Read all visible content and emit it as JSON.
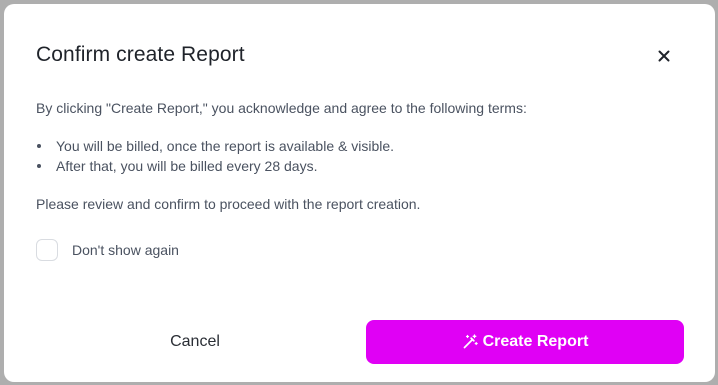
{
  "dialog": {
    "title": "Confirm create Report",
    "intro": "By clicking \"Create Report,\" you acknowledge and agree to the following terms:",
    "terms": [
      "You will be billed, once the report is available & visible.",
      "After that, you will be billed every 28 days."
    ],
    "review_note": "Please review and confirm to proceed with the report creation.",
    "checkbox": {
      "label": "Don't show again",
      "checked": false
    },
    "buttons": {
      "cancel_label": "Cancel",
      "create_label": "Create Report"
    },
    "icons": {
      "close": "close-icon",
      "create": "magic-wand-icon"
    },
    "colors": {
      "accent": "#e000f5",
      "overlay": "#aeaeae",
      "title_text": "#1f232a",
      "body_text": "#4a5260"
    }
  }
}
